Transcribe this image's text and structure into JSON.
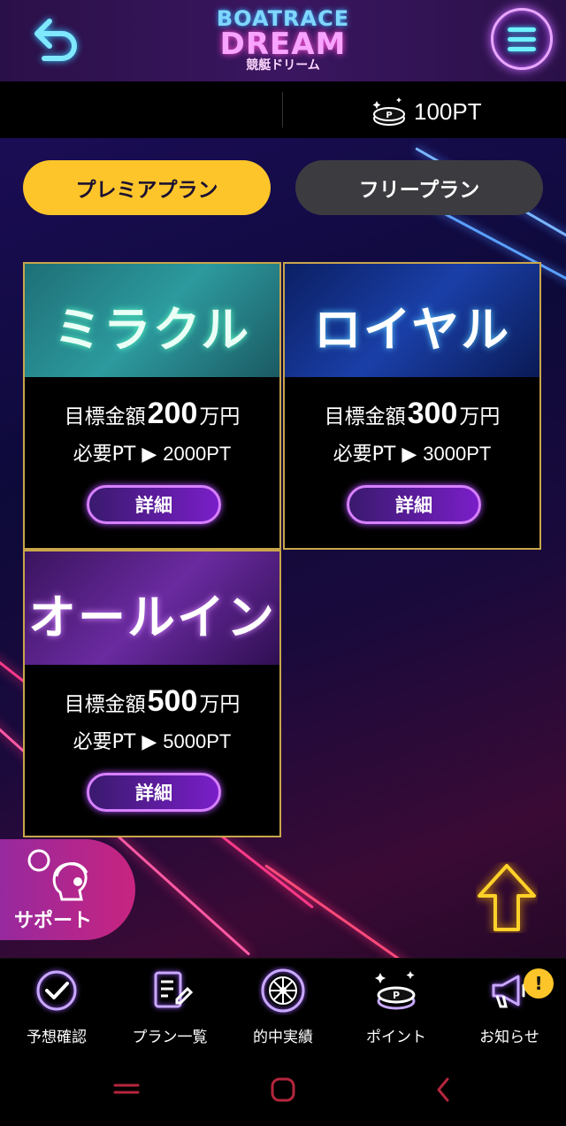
{
  "header": {
    "logo_line1": "BOATRACE",
    "logo_line2": "DREAM",
    "logo_line3": "競艇ドリーム"
  },
  "account": {
    "points": "100PT"
  },
  "tabs": [
    {
      "label": "プレミアプラン",
      "active": true
    },
    {
      "label": "フリープラン",
      "active": false
    }
  ],
  "plans": [
    {
      "name": "ミラクル",
      "target_label": "目標金額",
      "target_amount": "200",
      "target_unit": "万円",
      "required_label": "必要PT ▶",
      "required_value": "2000PT",
      "button": "詳細"
    },
    {
      "name": "ロイヤル",
      "target_label": "目標金額",
      "target_amount": "300",
      "target_unit": "万円",
      "required_label": "必要PT ▶",
      "required_value": "3000PT",
      "button": "詳細"
    },
    {
      "name": "オールイン",
      "target_label": "目標金額",
      "target_amount": "500",
      "target_unit": "万円",
      "required_label": "必要PT ▶",
      "required_value": "5000PT",
      "button": "詳細"
    }
  ],
  "support": {
    "label": "サポート"
  },
  "bottom_nav": [
    {
      "label": "予想確認",
      "icon": "check-circle-icon"
    },
    {
      "label": "プラン一覧",
      "icon": "document-edit-icon"
    },
    {
      "label": "的中実績",
      "icon": "roulette-icon"
    },
    {
      "label": "ポイント",
      "icon": "coin-point-icon"
    },
    {
      "label": "お知らせ",
      "icon": "megaphone-icon"
    }
  ],
  "notification_badge": "!",
  "colors": {
    "accent_yellow": "#fdc52a",
    "neon_purple": "#b04bff",
    "neon_cyan": "#6ff0ff",
    "card_border": "#c9a64a"
  }
}
